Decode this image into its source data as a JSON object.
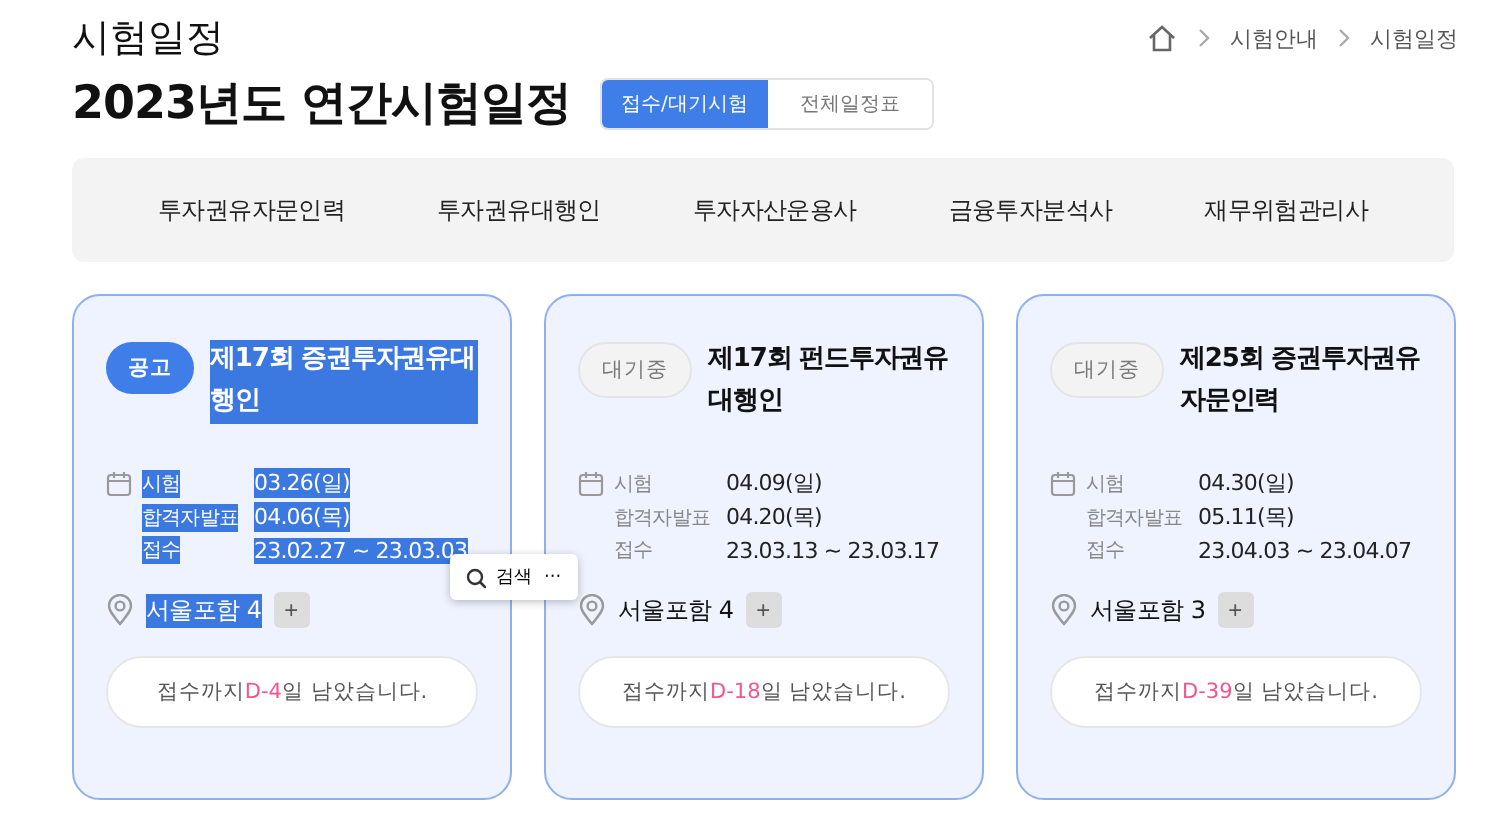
{
  "header": {
    "section_title": "시험일정",
    "breadcrumb": [
      "시험안내",
      "시험일정"
    ],
    "page_title": "2023년도 연간시험일정",
    "tabs": [
      {
        "label": "접수/대기시험",
        "selected": true
      },
      {
        "label": "전체일정표",
        "selected": false
      }
    ]
  },
  "category_nav": [
    "투자권유자문인력",
    "투자권유대행인",
    "투자자산운용사",
    "금융투자분석사",
    "재무위험관리사"
  ],
  "cards": [
    {
      "kind": "notice",
      "badge": "공고",
      "title": "제17회 증권투자권유대행인",
      "highlighted": true,
      "schedule": [
        {
          "label": "시험",
          "value": "03.26(일)"
        },
        {
          "label": "합격자발표",
          "value": "04.06(목)"
        },
        {
          "label": "접수",
          "value": "23.02.27 ~ 23.03.03"
        }
      ],
      "location": "서울포함 4",
      "more": "+",
      "notice_prefix": "접수까지",
      "dday": "D-4",
      "notice_suffix": "일 남았습니다."
    },
    {
      "kind": "waiting",
      "badge": "대기중",
      "title": "제17회 펀드투자권유대행인",
      "highlighted": false,
      "schedule": [
        {
          "label": "시험",
          "value": "04.09(일)"
        },
        {
          "label": "합격자발표",
          "value": "04.20(목)"
        },
        {
          "label": "접수",
          "value": "23.03.13 ~ 23.03.17"
        }
      ],
      "location": "서울포함 4",
      "more": "+",
      "notice_prefix": "접수까지",
      "dday": "D-18",
      "notice_suffix": "일 남았습니다."
    },
    {
      "kind": "waiting",
      "badge": "대기중",
      "title": "제25회 증권투자권유자문인력",
      "highlighted": false,
      "schedule": [
        {
          "label": "시험",
          "value": "04.30(일)"
        },
        {
          "label": "합격자발표",
          "value": "05.11(목)"
        },
        {
          "label": "접수",
          "value": "23.04.03 ~ 23.04.07"
        }
      ],
      "location": "서울포함 3",
      "more": "+",
      "notice_prefix": "접수까지",
      "dday": "D-39",
      "notice_suffix": "일 남았습니다."
    }
  ],
  "selection_popup": {
    "label": "검색",
    "more": "···"
  }
}
